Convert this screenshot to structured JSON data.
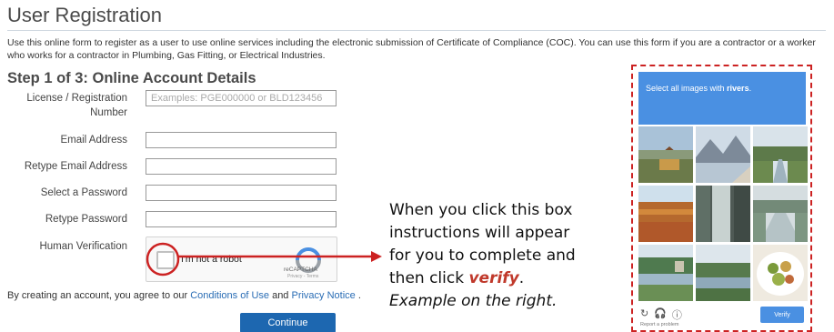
{
  "page": {
    "title": "User Registration",
    "intro": "Use this online form to register as a user to use online services including the electronic submission of Certificate of Compliance (COC). You can use this form if you are a contractor or a worker who works for a contractor in Plumbing, Gas Fitting, or Electrical Industries.",
    "step_title": "Step 1 of 3: Online Account Details"
  },
  "form": {
    "license_label": "License / Registration Number",
    "license_placeholder": "Examples: PGE000000 or BLD123456",
    "license_value": "",
    "email_label": "Email Address",
    "email_value": "",
    "retype_email_label": "Retype Email Address",
    "retype_email_value": "",
    "password_label": "Select a Password",
    "password_value": "",
    "retype_password_label": "Retype Password",
    "retype_password_value": "",
    "human_label": "Human Verification"
  },
  "recaptcha": {
    "checkbox_label": "I'm not a robot",
    "brand": "reCAPTCHA",
    "terms": "Privacy - Terms"
  },
  "agreement": {
    "prefix": "By creating an account, you agree to our ",
    "conditions_link": "Conditions of Use",
    "and": " and ",
    "privacy_link": "Privacy Notice",
    "suffix": " ."
  },
  "continue_label": "Continue",
  "callout": {
    "line1": "When you click this box",
    "line2": "instructions will appear",
    "line3": "for you to complete and",
    "line4_prefix": "then click ",
    "line4_verify": "verify",
    "line4_suffix": ".",
    "line5": "Example on the right."
  },
  "captcha_challenge": {
    "prompt_prefix": "Select all images with ",
    "prompt_keyword": "rivers",
    "prompt_suffix": ".",
    "verify_label": "Verify",
    "report_label": "Report a problem",
    "tiles": [
      "house-landscape",
      "mountain-lake",
      "river-trees",
      "autumn-lake",
      "waterfall",
      "river-fog",
      "river-bank",
      "river-town",
      "food-plate"
    ]
  },
  "colors": {
    "brand_blue": "#1d67b0",
    "captcha_blue": "#4a90e2",
    "annotation_red": "#cc2222",
    "link_blue": "#2a6db5"
  }
}
